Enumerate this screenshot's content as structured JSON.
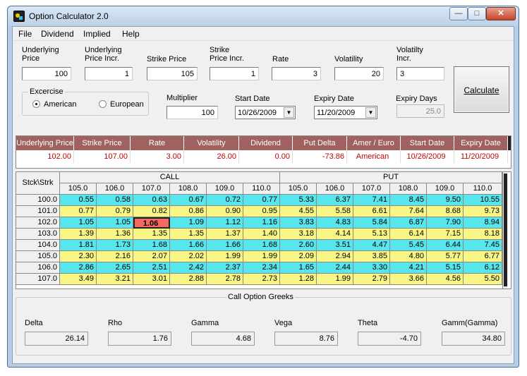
{
  "window": {
    "title": "Option Calculator 2.0",
    "min_label": "—",
    "max_label": "□",
    "close_label": "✕"
  },
  "menu": [
    {
      "label": "File"
    },
    {
      "label": "Dividend"
    },
    {
      "label": "Implied"
    },
    {
      "label": "Help"
    }
  ],
  "inputs": {
    "underlying_price": {
      "label": "Underlying\nPrice",
      "value": "100"
    },
    "underlying_price_incr": {
      "label": "Underlying\nPrice Incr.",
      "value": "1"
    },
    "strike_price": {
      "label": "Strike Price",
      "value": "105"
    },
    "strike_price_incr": {
      "label": "Strike\nPrice Incr.",
      "value": "1"
    },
    "rate": {
      "label": "Rate",
      "value": "3"
    },
    "volatility": {
      "label": "Volatility",
      "value": "20"
    },
    "volatility_incr": {
      "label": "Volatilty\nIncr.",
      "value": "3"
    },
    "multiplier": {
      "label": "Multiplier",
      "value": "100"
    },
    "start_date": {
      "label": "Start Date",
      "value": "10/26/2009"
    },
    "expiry_date": {
      "label": "Expiry Date",
      "value": "11/20/2009"
    },
    "expiry_days": {
      "label": "Expiry Days",
      "value": "25.0"
    }
  },
  "exercise": {
    "title": "Excercise",
    "american": "American",
    "european": "European",
    "selected": "American"
  },
  "calculate_label": "Calculate",
  "summary": {
    "headers": [
      "Underlying Price",
      "Strike Price",
      "Rate",
      "Volatility",
      "Dividend",
      "Put Delta",
      "Amer / Euro",
      "Start Date",
      "Expiry Date"
    ],
    "values": [
      "102.00",
      "107.00",
      "3.00",
      "26.00",
      "0.00",
      "-73.86",
      "American",
      "10/26/2009",
      "11/20/2009"
    ]
  },
  "matrix": {
    "corner": "Stck\\Strk",
    "call_label": "CALL",
    "put_label": "PUT",
    "strikes": [
      "105.0",
      "106.0",
      "107.0",
      "108.0",
      "109.0",
      "110.0"
    ],
    "stocks": [
      "100.0",
      "101.0",
      "102.0",
      "103.0",
      "104.0",
      "105.0",
      "106.0",
      "107.0"
    ],
    "call": [
      [
        "0.55",
        "0.58",
        "0.63",
        "0.67",
        "0.72",
        "0.77"
      ],
      [
        "0.77",
        "0.79",
        "0.82",
        "0.86",
        "0.90",
        "0.95"
      ],
      [
        "1.05",
        "1.05",
        "1.06",
        "1.09",
        "1.12",
        "1.16"
      ],
      [
        "1.39",
        "1.36",
        "1.35",
        "1.35",
        "1.37",
        "1.40"
      ],
      [
        "1.81",
        "1.73",
        "1.68",
        "1.66",
        "1.66",
        "1.68"
      ],
      [
        "2.30",
        "2.16",
        "2.07",
        "2.02",
        "1.99",
        "1.99"
      ],
      [
        "2.86",
        "2.65",
        "2.51",
        "2.42",
        "2.37",
        "2.34"
      ],
      [
        "3.49",
        "3.21",
        "3.01",
        "2.88",
        "2.78",
        "2.73"
      ]
    ],
    "put": [
      [
        "5.33",
        "6.37",
        "7.41",
        "8.45",
        "9.50",
        "10.55"
      ],
      [
        "4.55",
        "5.58",
        "6.61",
        "7.64",
        "8.68",
        "9.73"
      ],
      [
        "3.83",
        "4.83",
        "5.84",
        "6.87",
        "7.90",
        "8.94"
      ],
      [
        "3.18",
        "4.14",
        "5.13",
        "6.14",
        "7.15",
        "8.18"
      ],
      [
        "2.60",
        "3.51",
        "4.47",
        "5.45",
        "6.44",
        "7.45"
      ],
      [
        "2.09",
        "2.94",
        "3.85",
        "4.80",
        "5.77",
        "6.77"
      ],
      [
        "1.65",
        "2.44",
        "3.30",
        "4.21",
        "5.15",
        "6.12"
      ],
      [
        "1.28",
        "1.99",
        "2.79",
        "3.66",
        "4.56",
        "5.50"
      ]
    ],
    "colors": {
      "cyan": "#58e6ee",
      "yellow": "#f9f686",
      "highlight": "#f46a60"
    }
  },
  "greeks": {
    "title": "Call Option Greeks",
    "items": [
      {
        "label": "Delta",
        "value": "26.14"
      },
      {
        "label": "Rho",
        "value": "1.76"
      },
      {
        "label": "Gamma",
        "value": "4.68"
      },
      {
        "label": "Vega",
        "value": "8.76"
      },
      {
        "label": "Theta",
        "value": "-4.70"
      },
      {
        "label": "Gamm(Gamma)",
        "value": "34.80"
      }
    ]
  }
}
